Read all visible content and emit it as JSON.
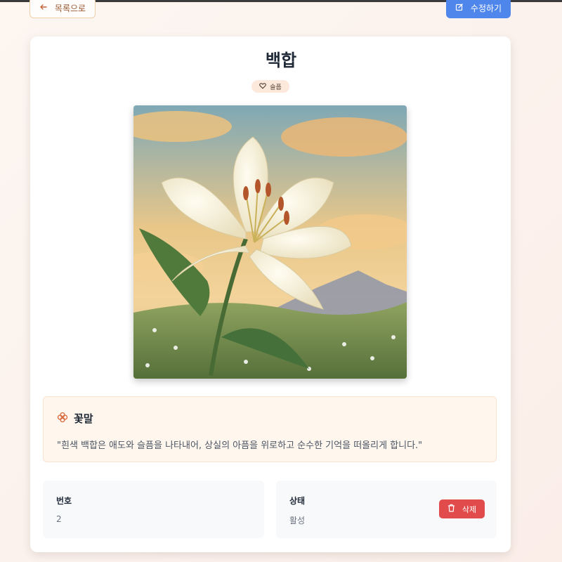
{
  "toolbar": {
    "back_label": "목록으로",
    "edit_label": "수정하기"
  },
  "flower": {
    "name": "백합",
    "emotion_badge": "슬픔",
    "image_icon": "lily-painting"
  },
  "meaning": {
    "title": "꽃말",
    "text": "\"흰색 백합은 애도와 슬픔을 나타내어, 상실의 아픔을 위로하고 순수한 기억을 떠올리게 합니다.\""
  },
  "details": {
    "number_label": "번호",
    "number_value": "2",
    "status_label": "상태",
    "status_value": "활성",
    "delete_label": "삭제"
  },
  "colors": {
    "accent_blue": "#4f86ec",
    "danger_red": "#e24b4b",
    "back_border": "#f0cfa8",
    "badge_bg": "#fde8dc",
    "meaning_bg": "#fff6ee"
  },
  "icons": {
    "back": "arrow-left-icon",
    "edit": "edit-icon",
    "badge": "heart-icon",
    "meaning": "flower-icon",
    "delete": "trash-icon"
  }
}
